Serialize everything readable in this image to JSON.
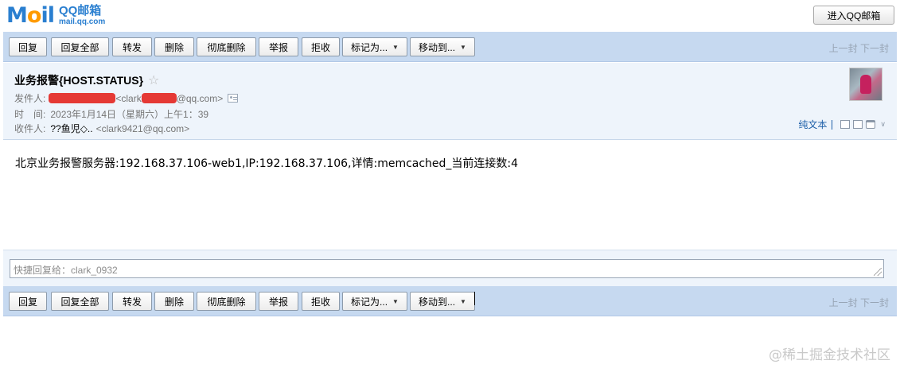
{
  "logo": {
    "mark_prefix": "M",
    "mark_o": "o",
    "mark_suffix": "il",
    "product": "QQ邮箱",
    "domain": "mail.qq.com"
  },
  "top_button": "进入QQ邮箱",
  "toolbar": {
    "reply": "回复",
    "reply_all": "回复全部",
    "forward": "转发",
    "delete": "删除",
    "delete_forever": "彻底删除",
    "report": "举报",
    "reject": "拒收",
    "mark_as": "标记为...",
    "move_to": "移动到...",
    "prev": "上一封",
    "next": "下一封"
  },
  "email": {
    "subject": "业务报警{HOST.STATUS}",
    "star": "☆",
    "from_label": "发件人:",
    "from_addr_prefix": "<clark",
    "from_addr_suffix": "@qq.com>",
    "time_label": "时　间:",
    "time_value": "2023年1月14日（星期六）上午1：39",
    "to_label": "收件人:",
    "to_name": "??鱼児◇..",
    "to_addr": "<clark9421@qq.com>",
    "plain_text": "纯文本",
    "body": "北京业务报警服务器:192.168.37.106-web1,IP:192.168.37.106,详情:memcached_当前连接数:4"
  },
  "quick_reply": {
    "placeholder": "快捷回复给：clark_0932"
  },
  "watermark": "@稀土掘金技术社区",
  "colors": {
    "toolbar_bg": "#c6d9f0",
    "header_bg": "#eef4fb",
    "link": "#1d5fa8",
    "redaction": "#e53935"
  }
}
